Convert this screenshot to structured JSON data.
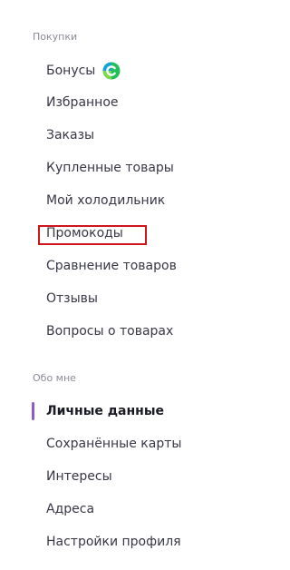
{
  "sections": [
    {
      "title": "Покупки",
      "items": [
        {
          "label": "Бонусы"
        },
        {
          "label": "Избранное"
        },
        {
          "label": "Заказы"
        },
        {
          "label": "Купленные товары"
        },
        {
          "label": "Мой холодильник"
        },
        {
          "label": "Промокоды"
        },
        {
          "label": "Сравнение товаров"
        },
        {
          "label": "Отзывы"
        },
        {
          "label": "Вопросы о товарах"
        }
      ]
    },
    {
      "title": "Обо мне",
      "items": [
        {
          "label": "Личные данные"
        },
        {
          "label": "Сохранённые карты"
        },
        {
          "label": "Интересы"
        },
        {
          "label": "Адреса"
        },
        {
          "label": "Настройки профиля"
        }
      ]
    }
  ],
  "active_item": "Личные данные",
  "highlighted_item": "Промокоды",
  "colors": {
    "accent": "#8a5cc7",
    "highlight_border": "#d0141e",
    "bonus_badge": "#21a038"
  },
  "icons": {
    "bonus": "bonus-badge-icon"
  }
}
